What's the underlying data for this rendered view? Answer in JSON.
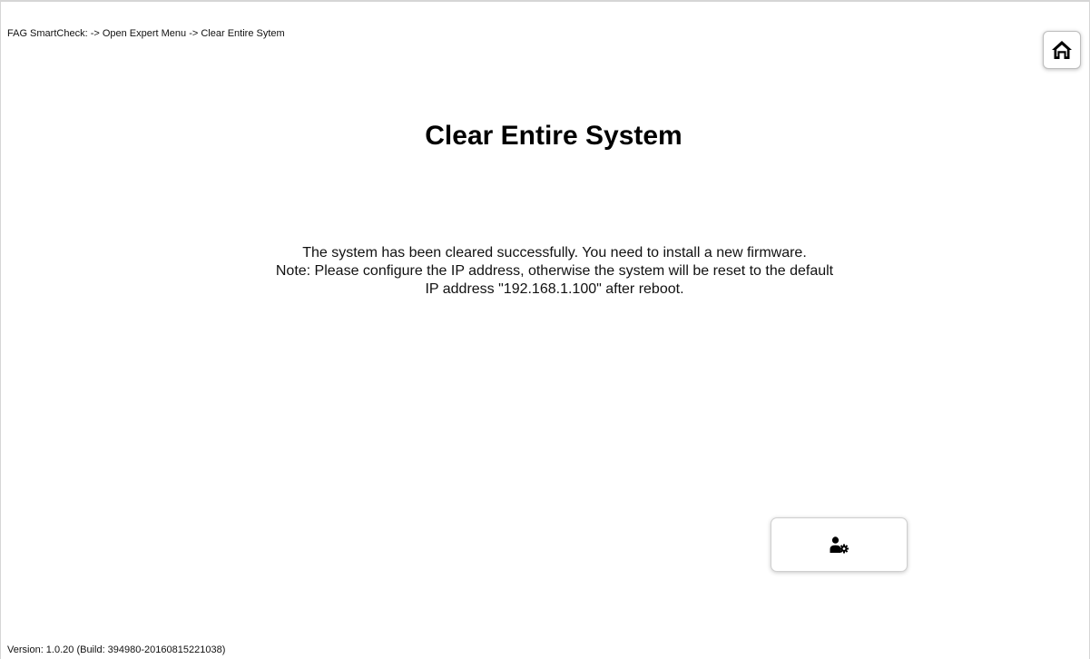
{
  "header": {
    "breadcrumb": "FAG SmartCheck: -> Open Expert Menu -> Clear Entire Sytem",
    "home_icon": "home-icon"
  },
  "main": {
    "title": "Clear Entire System",
    "message_line1": "The system has been cleared successfully. You need to install a new firmware.",
    "message_line2": "Note: Please configure the IP address, otherwise the system will be reset to the default IP address \"192.168.1.100\" after reboot."
  },
  "actions": {
    "expert_icon": "user-settings-icon"
  },
  "footer": {
    "version": "Version: 1.0.20 (Build: 394980-20160815221038)"
  }
}
